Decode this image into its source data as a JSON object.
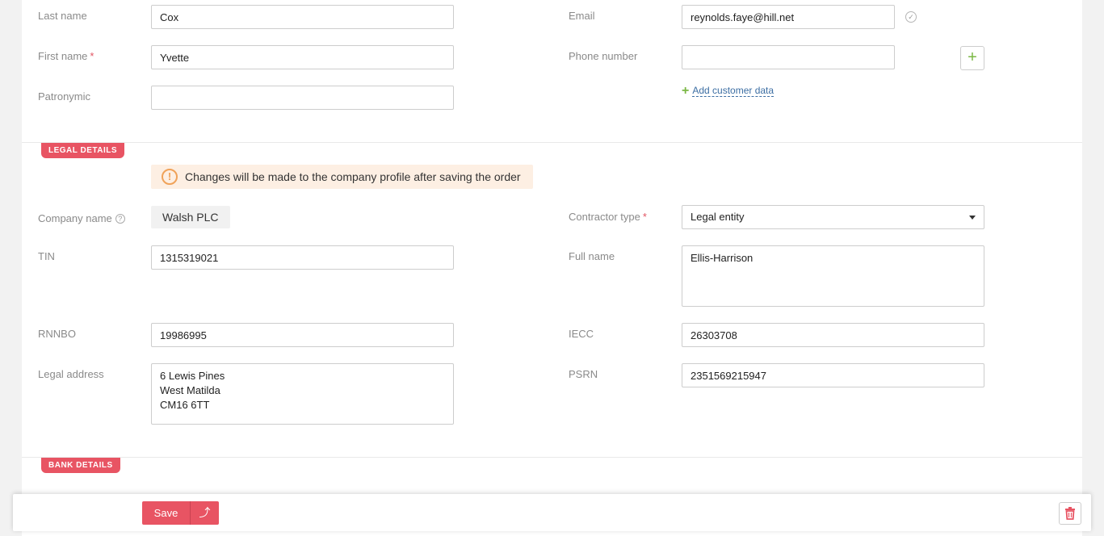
{
  "customer": {
    "last_name": {
      "label": "Last name",
      "value": "Cox"
    },
    "first_name": {
      "label": "First name",
      "required_mark": "*",
      "value": "Yvette"
    },
    "patronymic": {
      "label": "Patronymic",
      "value": ""
    },
    "email": {
      "label": "Email",
      "value": "reynolds.faye@hill.net"
    },
    "phone": {
      "label": "Phone number",
      "value": ""
    },
    "add_plus": "+",
    "add_customer_data": "Add customer data"
  },
  "legal": {
    "section_title": "LEGAL DETAILS",
    "notice": "Changes will be made to the company profile after saving the order",
    "notice_icon": "!",
    "company_name": {
      "label": "Company name",
      "value": "Walsh PLC",
      "help": "?"
    },
    "contractor_type": {
      "label": "Contractor type",
      "required_mark": "*",
      "value": "Legal entity"
    },
    "tin": {
      "label": "TIN",
      "value": "1315319021"
    },
    "full_name": {
      "label": "Full name",
      "value": "Ellis-Harrison"
    },
    "rnnbo": {
      "label": "RNNBO",
      "value": "19986995"
    },
    "iecc": {
      "label": "IECC",
      "value": "26303708"
    },
    "legal_address": {
      "label": "Legal address",
      "value": "6 Lewis Pines\nWest Matilda\nCM16 6TT"
    },
    "psrn": {
      "label": "PSRN",
      "value": "2351569215947"
    }
  },
  "bank": {
    "section_title": "BANK DETAILS"
  },
  "footer": {
    "save_label": "Save",
    "save_menu_icon": "⤴"
  },
  "colors": {
    "accent": "#e85463",
    "green": "#7ab743",
    "link": "#3c6ea3",
    "notice_bg": "#fdefe3"
  }
}
